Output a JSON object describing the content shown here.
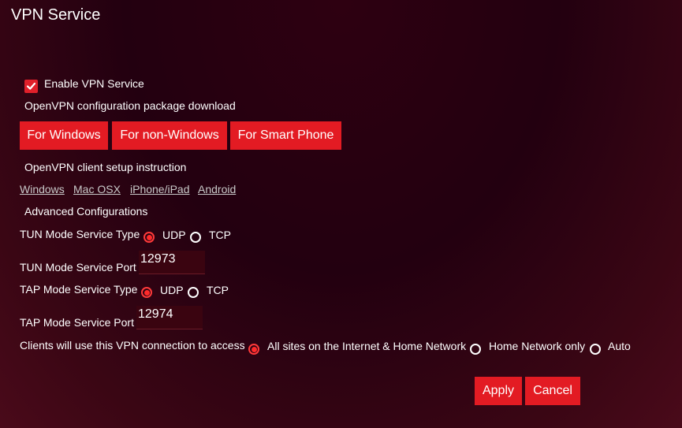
{
  "page": {
    "title": "VPN Service"
  },
  "enable": {
    "label": "Enable VPN Service",
    "checked": true
  },
  "config_download": {
    "label": "OpenVPN configuration package download",
    "buttons": [
      "For Windows",
      "For non-Windows",
      "For Smart Phone"
    ]
  },
  "instructions": {
    "label": "OpenVPN client setup instruction",
    "links": [
      "Windows",
      "Mac OSX",
      "iPhone/iPad",
      "Android"
    ]
  },
  "advanced": {
    "label": "Advanced Configurations",
    "tun_type": {
      "label": "TUN Mode Service Type",
      "options": [
        "UDP",
        "TCP"
      ],
      "selected": "UDP"
    },
    "tun_port": {
      "label": "TUN Mode Service Port",
      "value": "12973"
    },
    "tap_type": {
      "label": "TAP Mode Service Type",
      "options": [
        "UDP",
        "TCP"
      ],
      "selected": "UDP"
    },
    "tap_port": {
      "label": "TAP Mode Service Port",
      "value": "12974"
    },
    "clients_access": {
      "label": "Clients will use this VPN connection to access",
      "options": [
        "All sites on the Internet & Home Network",
        "Home Network only",
        "Auto"
      ],
      "selected": "All sites on the Internet & Home Network"
    }
  },
  "actions": {
    "apply": "Apply",
    "cancel": "Cancel"
  },
  "colors": {
    "accent": "#e31b23",
    "background": "#230010"
  }
}
